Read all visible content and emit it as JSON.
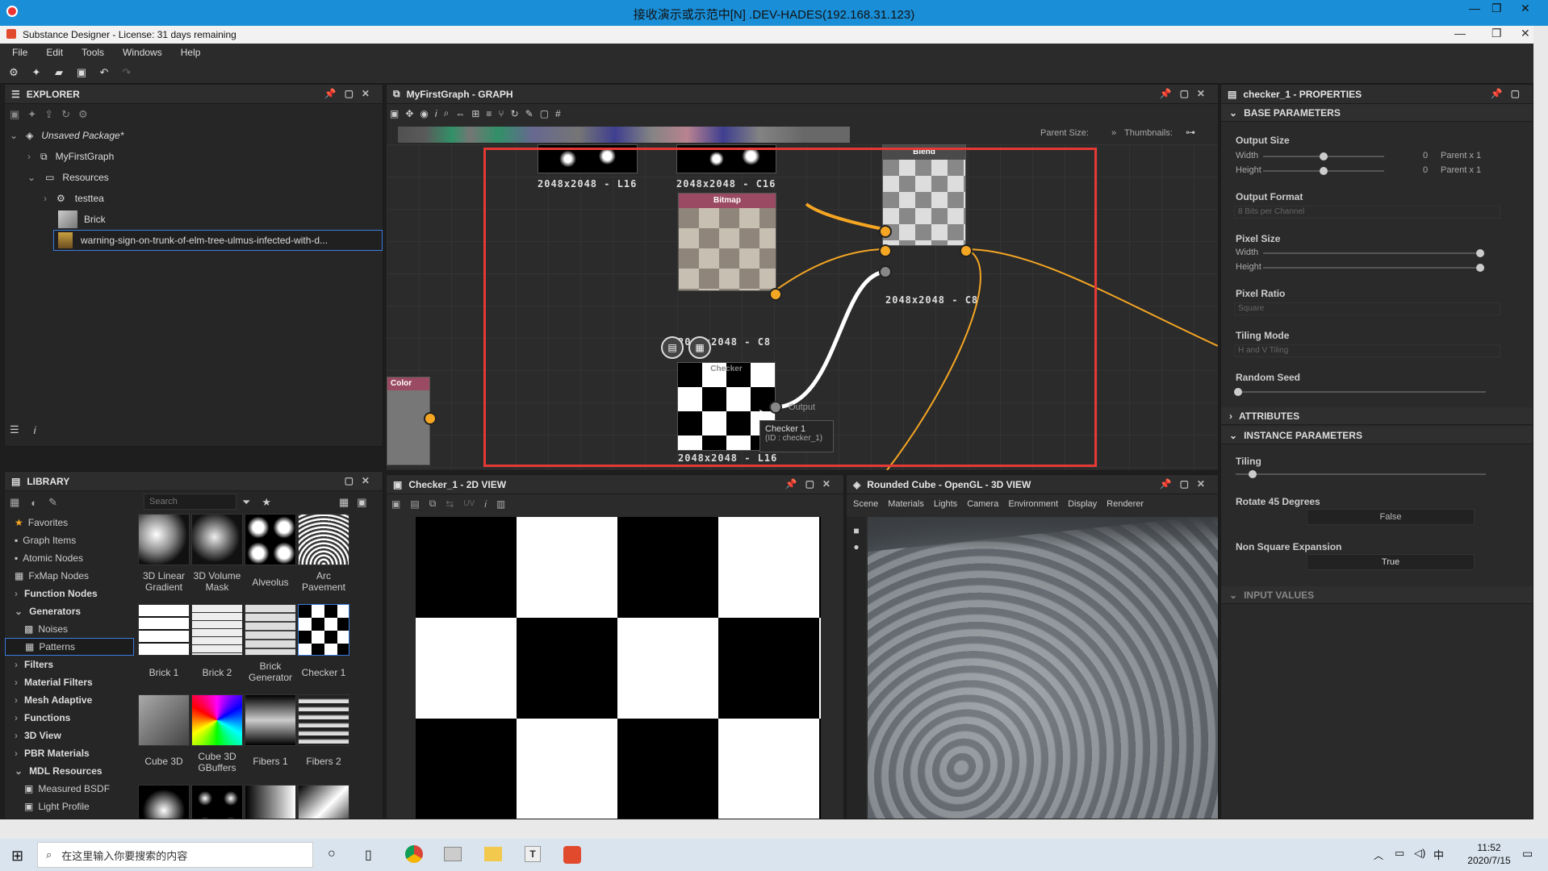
{
  "remote_title": "接收演示或示范中[N] .DEV-HADES(192.168.31.123)",
  "app_title": "Substance Designer - License: 31 days remaining",
  "menu": [
    "File",
    "Edit",
    "Tools",
    "Windows",
    "Help"
  ],
  "explorer": {
    "title": "EXPLORER",
    "package": "Unsaved Package*",
    "graph": "MyFirstGraph",
    "resources": "Resources",
    "items": [
      "testtea",
      "Brick",
      "warning-sign-on-trunk-of-elm-tree-ulmus-infected-with-d..."
    ]
  },
  "library": {
    "title": "LIBRARY",
    "search_placeholder": "Search",
    "categories": [
      "Favorites",
      "Graph Items",
      "Atomic Nodes",
      "FxMap Nodes",
      "Function Nodes",
      "Generators",
      "Noises",
      "Patterns",
      "Filters",
      "Material Filters",
      "Mesh Adaptive",
      "Functions",
      "3D View",
      "PBR Materials",
      "MDL Resources",
      "Measured BSDF",
      "Light Profile"
    ],
    "thumbs_row1": [
      "3D Linear Gradient",
      "3D Volume Mask",
      "Alveolus",
      "Arc Pavement"
    ],
    "thumbs_row2": [
      "Brick 1",
      "Brick 2",
      "Brick Generator",
      "Checker 1"
    ],
    "thumbs_row3": [
      "Cube 3D",
      "Cube 3D GBuffers",
      "Fibers 1",
      "Fibers 2"
    ]
  },
  "graph": {
    "title": "MyFirstGraph - GRAPH",
    "parent_size": "Parent Size:",
    "thumbnails": "Thumbnails:",
    "nodes": {
      "top1_label": "2048x2048 - L16",
      "top2_label": "2048x2048 - C16",
      "bitmap_title": "Bitmap",
      "bitmap_label": "2048x2048 - C8",
      "blend_title": "Blend",
      "blend_label": "2048x2048 - C8",
      "checker_title": "Checker",
      "checker_label": "2048x2048 - L16",
      "color_title": "Color",
      "output_label": "Output"
    },
    "tooltip": {
      "name": "Checker 1",
      "id": "(ID : checker_1)"
    }
  },
  "view2d": {
    "title": "Checker_1 - 2D VIEW",
    "uv": "UV"
  },
  "view3d": {
    "title": "Rounded Cube - OpenGL - 3D VIEW",
    "menu": [
      "Scene",
      "Materials",
      "Lights",
      "Camera",
      "Environment",
      "Display",
      "Renderer"
    ]
  },
  "properties": {
    "title": "checker_1 - PROPERTIES",
    "base_params": "BASE PARAMETERS",
    "output_size": "Output Size",
    "width": "Width",
    "height": "Height",
    "zero": "0",
    "parent_x1": "Parent x 1",
    "output_format": "Output Format",
    "output_format_value": "8 Bits per Channel",
    "pixel_size": "Pixel Size",
    "pixel_ratio": "Pixel Ratio",
    "pixel_ratio_value": "Square",
    "tiling_mode": "Tiling Mode",
    "tiling_mode_value": "H and V Tiling",
    "random_seed": "Random Seed",
    "attributes": "ATTRIBUTES",
    "instance_params": "INSTANCE PARAMETERS",
    "tiling": "Tiling",
    "rotate45": "Rotate 45 Degrees",
    "rotate45_value": "False",
    "non_square": "Non Square Expansion",
    "non_square_value": "True",
    "input_values": "INPUT VALUES"
  },
  "taskbar": {
    "search": "在这里输入你要搜索的内容",
    "time": "11:52",
    "date": "2020/7/15",
    "ime": "中"
  }
}
